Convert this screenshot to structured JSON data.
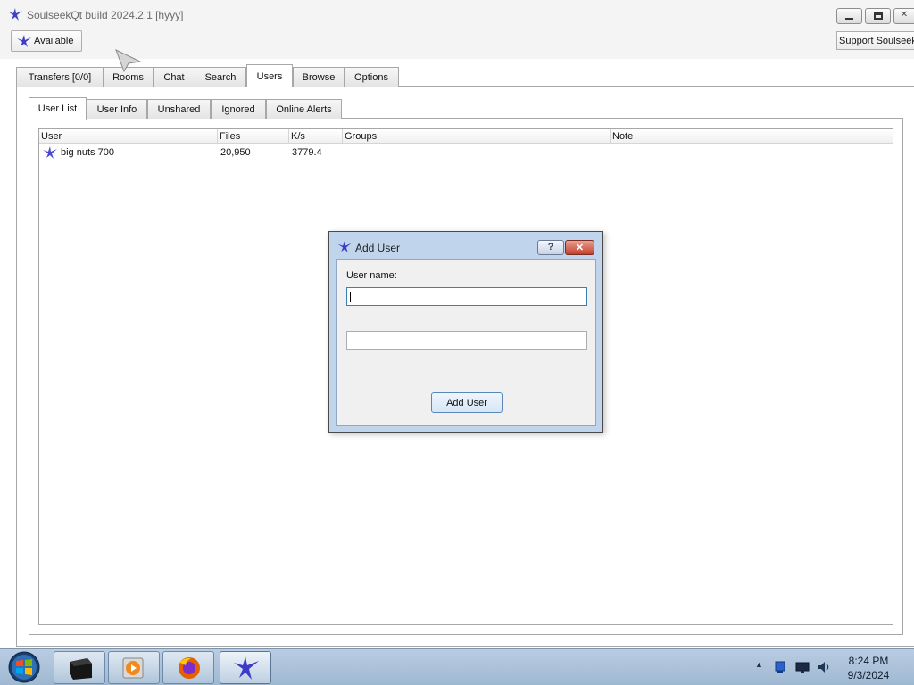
{
  "window": {
    "title": "SoulseekQt build 2024.2.1 [hyyy]",
    "controls": [
      "minimize",
      "maximize",
      "close"
    ]
  },
  "toolbar": {
    "status_label": "Available",
    "support_label": "Support Soulseek"
  },
  "main_tabs": [
    {
      "label": "Transfers [0/0]",
      "active": false
    },
    {
      "label": "Rooms",
      "active": false
    },
    {
      "label": "Chat",
      "active": false
    },
    {
      "label": "Search",
      "active": false
    },
    {
      "label": "Users",
      "active": true
    },
    {
      "label": "Browse",
      "active": false
    },
    {
      "label": "Options",
      "active": false
    }
  ],
  "sub_tabs": [
    {
      "label": "User List",
      "active": true
    },
    {
      "label": "User Info",
      "active": false
    },
    {
      "label": "Unshared",
      "active": false
    },
    {
      "label": "Ignored",
      "active": false
    },
    {
      "label": "Online Alerts",
      "active": false
    }
  ],
  "user_table": {
    "columns": [
      "User",
      "Files",
      "K/s",
      "Groups",
      "Note"
    ],
    "rows": [
      {
        "user": "big nuts 700",
        "files": "20,950",
        "speed": "3779.4",
        "groups": "",
        "note": ""
      }
    ]
  },
  "dialog": {
    "title": "Add User",
    "help_icon": "question-mark-icon",
    "close_icon": "close-icon",
    "username_label": "User name:",
    "username_value": "",
    "second_field_value": "",
    "button_label": "Add User"
  },
  "taskbar": {
    "items": [
      "start-orb-icon",
      "app-window-icon",
      "media-player-icon",
      "firefox-icon",
      "soulseek-icon"
    ],
    "active_item": "soulseek-icon",
    "tray_icons": [
      "show-hidden-icons-arrow",
      "network-icon",
      "display-icon",
      "volume-icon"
    ],
    "time": "8:24 PM",
    "date": "9/3/2024"
  },
  "colors": {
    "dialog_frame": "#c0d4ec",
    "close_red": "#c4402b",
    "taskbar": "#b9cde2",
    "soulseek_bird": "#3c3cc8"
  }
}
